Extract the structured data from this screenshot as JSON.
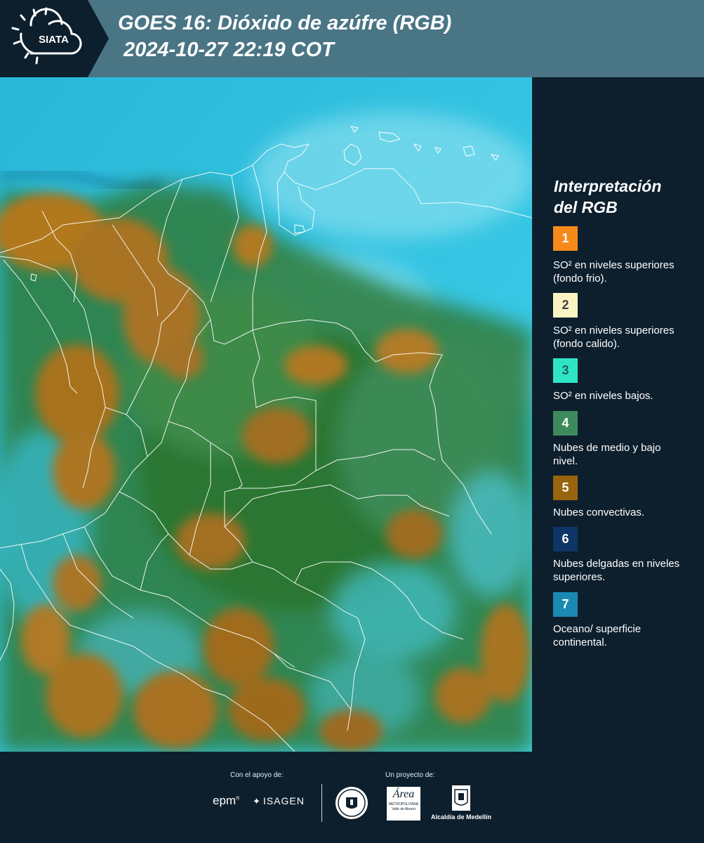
{
  "header": {
    "logo_text": "SIATA",
    "title_line1": "GOES 16: Dióxido de azúfre (RGB)",
    "title_line2": "2024-10-27 22:19 COT"
  },
  "legend": {
    "title_line1": "Interpretación",
    "title_line2": "del RGB",
    "items": [
      {
        "num": "1",
        "color": "#f58a1a",
        "text": "SO² en niveles superiores (fondo frio)."
      },
      {
        "num": "2",
        "color": "#fbf4c2",
        "text": "SO² en niveles superiores (fondo calido)."
      },
      {
        "num": "3",
        "color": "#2ee4c4",
        "text": "SO² en niveles bajos."
      },
      {
        "num": "4",
        "color": "#3e8a5c",
        "text": "Nubes de medio y bajo nivel."
      },
      {
        "num": "5",
        "color": "#99640e",
        "text": "Nubes convectivas."
      },
      {
        "num": "6",
        "color": "#0f3566",
        "text": "Nubes delgadas en niveles superiores."
      },
      {
        "num": "7",
        "color": "#1a8ab4",
        "text": "Oceano/ superficie continental."
      }
    ]
  },
  "footer": {
    "support_label": "Con el apoyo de:",
    "project_label": "Un proyecto de:",
    "epm": "epm",
    "isagen": "ISAGEN",
    "area_word": "Área",
    "area_sub1": "METROPOLITANA",
    "area_sub2": "Valle de Aburrá",
    "alcaldia": "Alcaldía de Medellín"
  },
  "map": {
    "ocean_color": "#33c6e4",
    "land_green": "#2f7d3c",
    "cloud_orange": "#a97422",
    "border_color": "#ffffff"
  }
}
